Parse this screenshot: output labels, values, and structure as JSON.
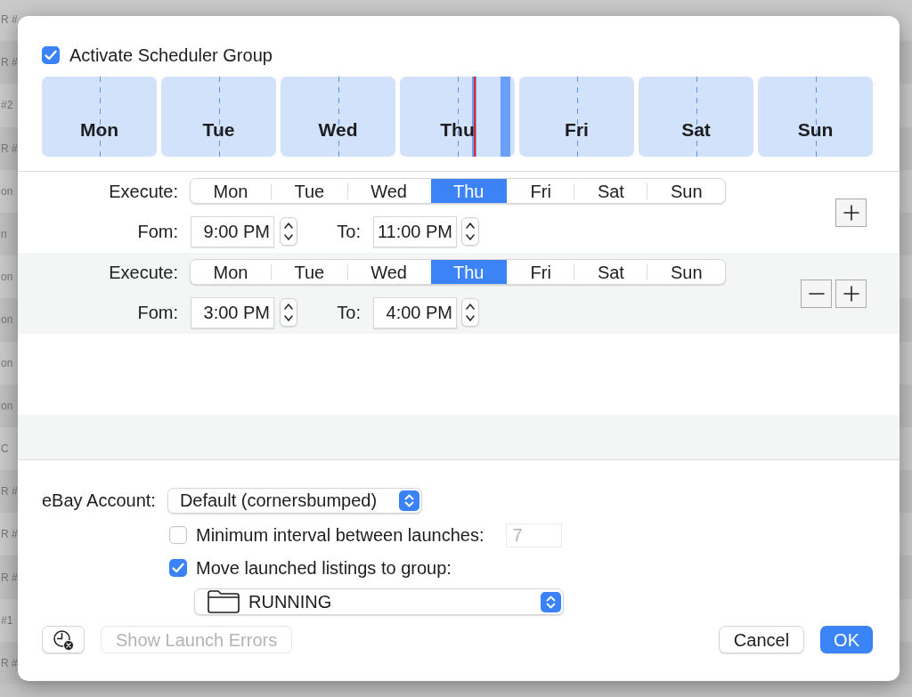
{
  "background_list": {
    "rows": [
      "R #",
      "R #",
      "#2",
      "R #",
      "on",
      "n",
      "on",
      "on",
      "on",
      "on",
      "C",
      "R #",
      "R #",
      "R #",
      "#1",
      "R #"
    ]
  },
  "dialog": {
    "activate_checkbox": {
      "label": "Activate Scheduler Group",
      "checked": true
    },
    "week_graph": {
      "days": [
        {
          "label": "Mon",
          "today": false
        },
        {
          "label": "Tue",
          "today": false
        },
        {
          "label": "Wed",
          "today": false
        },
        {
          "label": "Thu",
          "today": true
        },
        {
          "label": "Fri",
          "today": false
        },
        {
          "label": "Sat",
          "today": false
        },
        {
          "label": "Sun",
          "today": false
        }
      ],
      "now_marker": {
        "level": 0.653
      }
    },
    "schedules": [
      {
        "execute_label": "Execute:",
        "days": [
          {
            "label": "Mon",
            "selected": false
          },
          {
            "label": "Tue",
            "selected": false
          },
          {
            "label": "Wed",
            "selected": false
          },
          {
            "label": "Thu",
            "selected": true
          },
          {
            "label": "Fri",
            "selected": false
          },
          {
            "label": "Sat",
            "selected": false
          },
          {
            "label": "Sun",
            "selected": false
          }
        ],
        "from_label": "Fom:",
        "from": "9:00 PM",
        "to_label": "To:",
        "to": "11:00 PM",
        "buttons": [
          {
            "kind": "add"
          }
        ]
      },
      {
        "execute_label": "Execute:",
        "days": [
          {
            "label": "Mon",
            "selected": false
          },
          {
            "label": "Tue",
            "selected": false
          },
          {
            "label": "Wed",
            "selected": false
          },
          {
            "label": "Thu",
            "selected": true
          },
          {
            "label": "Fri",
            "selected": false
          },
          {
            "label": "Sat",
            "selected": false
          },
          {
            "label": "Sun",
            "selected": false
          }
        ],
        "from_label": "Fom:",
        "from": "3:00 PM",
        "to_label": "To:",
        "to": "4:00 PM",
        "buttons": [
          {
            "kind": "remove"
          },
          {
            "kind": "add"
          }
        ]
      }
    ],
    "account": {
      "label": "eBay Account:",
      "value": "Default (cornersbumped)"
    },
    "min_interval": {
      "label": "Minimum interval between launches:",
      "checked": false,
      "value": "7",
      "disabled": true
    },
    "move_to_group": {
      "label": "Move launched listings to group:",
      "checked": true,
      "group": "RUNNING"
    },
    "footer": {
      "left_buttons": [
        {
          "kind": "clock",
          "disabled": false
        },
        {
          "kind": "text",
          "label": "Show Launch Errors",
          "disabled": true
        }
      ],
      "right_buttons": [
        {
          "label": "Cancel",
          "default": false
        },
        {
          "label": "OK",
          "default": true
        }
      ]
    }
  }
}
